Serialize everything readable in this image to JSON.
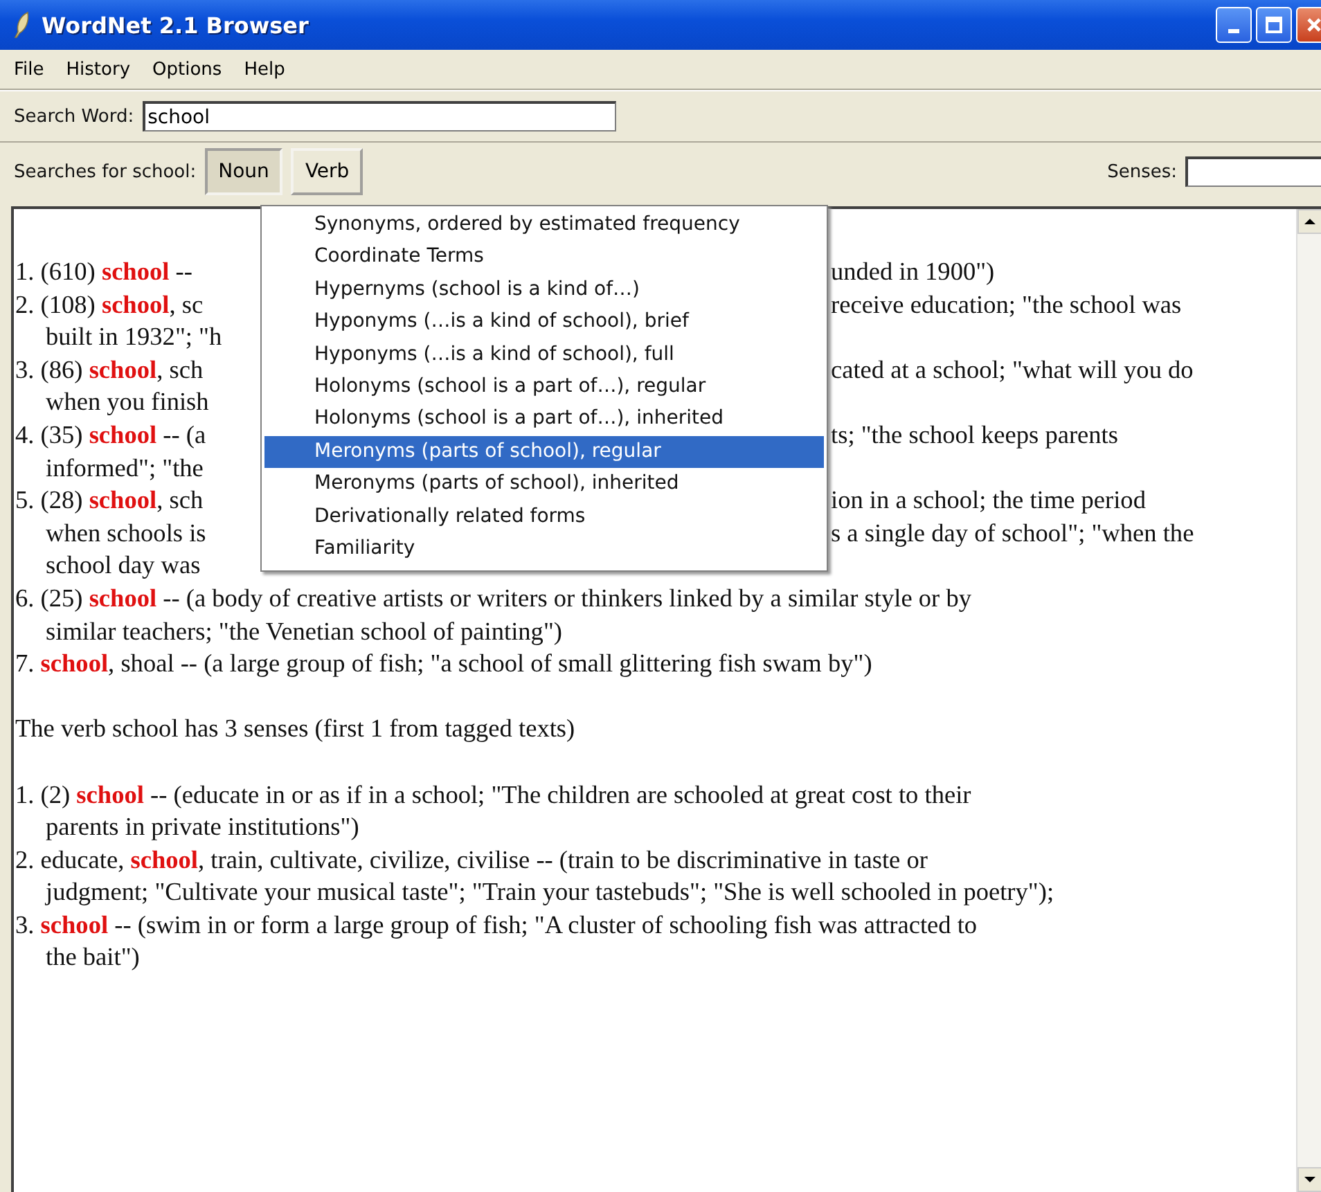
{
  "window": {
    "title": "WordNet 2.1 Browser"
  },
  "menu_bar": [
    "File",
    "History",
    "Options",
    "Help"
  ],
  "search": {
    "label": "Search Word:",
    "value": "school"
  },
  "searches": {
    "label": "Searches for school:",
    "buttons": [
      {
        "label": "Noun",
        "selected": true
      },
      {
        "label": "Verb",
        "selected": false
      }
    ],
    "senses_label": "Senses:"
  },
  "results": [
    {
      "lines": [
        {
          "kind": "sense",
          "left": "1. (610) **school** --",
          "right": "unded in 1900\")"
        },
        {
          "kind": "sense",
          "left": "2. (108) **school**, sc",
          "right": "receive education; \"the school was"
        },
        {
          "kind": "cont",
          "left": "built in 1932\"; \"h"
        },
        {
          "kind": "sense",
          "left": "3. (86) **school**, sch",
          "right": "cated at a school; \"what will you do"
        },
        {
          "kind": "cont",
          "left": "when you finish"
        },
        {
          "kind": "sense",
          "left": "4. (35) **school** -- (a",
          "right": "ts; \"the school keeps parents"
        },
        {
          "kind": "cont",
          "left": "informed\"; \"the"
        },
        {
          "kind": "sense",
          "left": "5. (28) **school**, sch",
          "right": "ion in a school; the time period"
        },
        {
          "kind": "cont",
          "left": "when schools is",
          "right": "s a single day of school\"; \"when the"
        },
        {
          "kind": "cont",
          "left": "school day was"
        },
        {
          "kind": "sense",
          "left": "6. (25) **school** -- (a body of creative artists or writers or thinkers linked by a similar style or by"
        },
        {
          "kind": "cont",
          "left": "similar teachers; \"the Venetian school of painting\")"
        },
        {
          "kind": "sense",
          "left": "7. **school**, shoal -- (a large group of fish; \"a school of small glittering fish swam by\")"
        }
      ]
    },
    {
      "lines": [
        {
          "kind": "sense",
          "left": "The verb school has 3 senses (first 1 from tagged texts)"
        }
      ]
    },
    {
      "lines": [
        {
          "kind": "sense",
          "left": "1. (2) **school** -- (educate in or as if in a school; \"The children are schooled at great cost to their"
        },
        {
          "kind": "cont",
          "left": "parents in private institutions\")"
        },
        {
          "kind": "sense",
          "left": "2. educate, **school**, train, cultivate, civilize, civilise -- (train to be discriminative in taste or"
        },
        {
          "kind": "cont",
          "left": "judgment; \"Cultivate your musical taste\"; \"Train your tastebuds\"; \"She is well schooled in poetry\");"
        },
        {
          "kind": "sense",
          "left": "3. **school** -- (swim in or form a large group of fish; \"A cluster of schooling fish was attracted to"
        },
        {
          "kind": "cont",
          "left": "the bait\")"
        }
      ]
    }
  ],
  "dropdown": [
    {
      "label": "Synonyms, ordered by estimated frequency",
      "selected": false
    },
    {
      "label": "Coordinate Terms",
      "selected": false
    },
    {
      "label": "Hypernyms (school is a kind of…)",
      "selected": false
    },
    {
      "label": "Hyponyms (…is a kind of school), brief",
      "selected": false
    },
    {
      "label": "Hyponyms (…is a kind of school), full",
      "selected": false
    },
    {
      "label": "Holonyms (school is a part of…), regular",
      "selected": false
    },
    {
      "label": "Holonyms (school is a part of…), inherited",
      "selected": false
    },
    {
      "label": "Meronyms (parts of school), regular",
      "selected": true
    },
    {
      "label": "Meronyms (parts of school), inherited",
      "selected": false
    },
    {
      "label": "Derivationally related forms",
      "selected": false
    },
    {
      "label": "Familiarity",
      "selected": false
    }
  ]
}
